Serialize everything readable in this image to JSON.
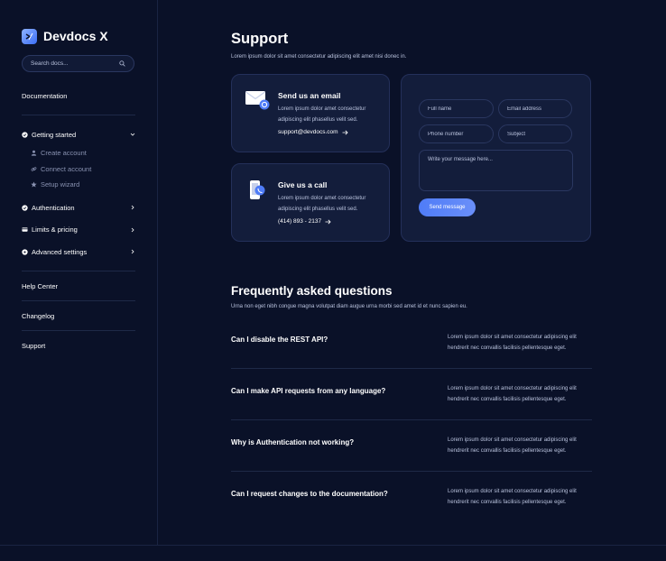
{
  "app": {
    "name": "Devdocs X"
  },
  "search": {
    "placeholder": "Search docs..."
  },
  "sidebar": {
    "documentation": "Documentation",
    "groups": [
      {
        "label": "Getting started",
        "icon": "check-circle-icon",
        "expanded": true,
        "items": [
          {
            "label": "Create account",
            "icon": "user-icon"
          },
          {
            "label": "Connect account",
            "icon": "link-icon"
          },
          {
            "label": "Setup wizard",
            "icon": "star-icon"
          }
        ]
      },
      {
        "label": "Authentication",
        "icon": "check-circle-icon"
      },
      {
        "label": "Limits & pricing",
        "icon": "card-icon"
      },
      {
        "label": "Advanced settings",
        "icon": "gear-icon"
      }
    ],
    "links": [
      "Help Center",
      "Changelog",
      "Support"
    ]
  },
  "page": {
    "title": "Support",
    "subtitle": "Lorem ipsum dolor sit amet consectetur adipiscing elit amet nisi donec in."
  },
  "contact": {
    "email": {
      "title": "Send us an email",
      "text": "Lorem ipsum dolor amet consectetur adipiscing elit phasellus velit sed.",
      "link": "support@devdocs.com"
    },
    "call": {
      "title": "Give us a call",
      "text": "Lorem ipsum dolor amet consectetur adipiscing elit phasellus velit sed.",
      "link": "(414) 893 - 2137"
    }
  },
  "form": {
    "full_name": "Full name",
    "email": "Email address",
    "phone": "Phone number",
    "subject": "Subject",
    "message": "Write your message here...",
    "submit": "Send message"
  },
  "faq": {
    "title": "Frequently asked questions",
    "subtitle": "Urna non eget nibh congue magna volutpat diam augue urna morbi sed amet id et nunc sapien eu.",
    "items": [
      {
        "q": "Can I disable the REST API?",
        "a": "Lorem ipsum dolor sit amet consectetur adipiscing elit hendrerit nec convallis facilisis pellentesque eget."
      },
      {
        "q": "Can I make API requests from any language?",
        "a": "Lorem ipsum dolor sit amet consectetur adipiscing elit hendrerit nec convallis facilisis pellentesque eget."
      },
      {
        "q": "Why is Authentication not working?",
        "a": "Lorem ipsum dolor sit amet consectetur adipiscing elit hendrerit nec convallis facilisis pellentesque eget."
      },
      {
        "q": "Can I request changes to the documentation?",
        "a": "Lorem ipsum dolor sit amet consectetur adipiscing elit hendrerit nec convallis facilisis pellentesque eget."
      }
    ]
  },
  "colors": {
    "background": "#0a1128",
    "card": "#131d3b",
    "accent": "#4f7cf7",
    "muted_text": "#b9c2dd"
  }
}
